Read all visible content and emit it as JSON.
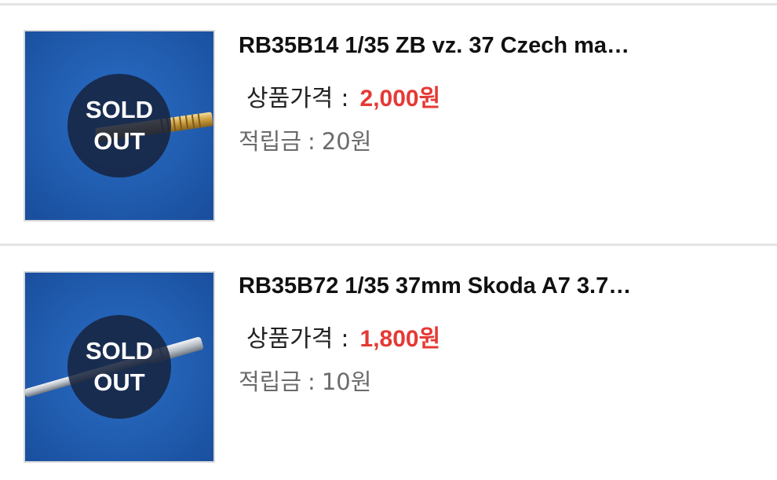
{
  "products": [
    {
      "title": "RB35B14 1/35 ZB vz. 37 Czech ma…",
      "badge_line1": "SOLD",
      "badge_line2": "OUT",
      "price_label": "상품가격",
      "price_colon": ":",
      "price_value": "2,000원",
      "points_label": "적립금",
      "points_colon": ":",
      "points_value": "20원"
    },
    {
      "title": "RB35B72 1/35 37mm Skoda A7 3.7…",
      "badge_line1": "SOLD",
      "badge_line2": "OUT",
      "price_label": "상품가격",
      "price_colon": ":",
      "price_value": "1,800원",
      "points_label": "적립금",
      "points_colon": ":",
      "points_value": "10원"
    }
  ],
  "colors": {
    "price": "#e53935",
    "thumb_background": "#1f5fb5",
    "badge": "#16223c"
  }
}
